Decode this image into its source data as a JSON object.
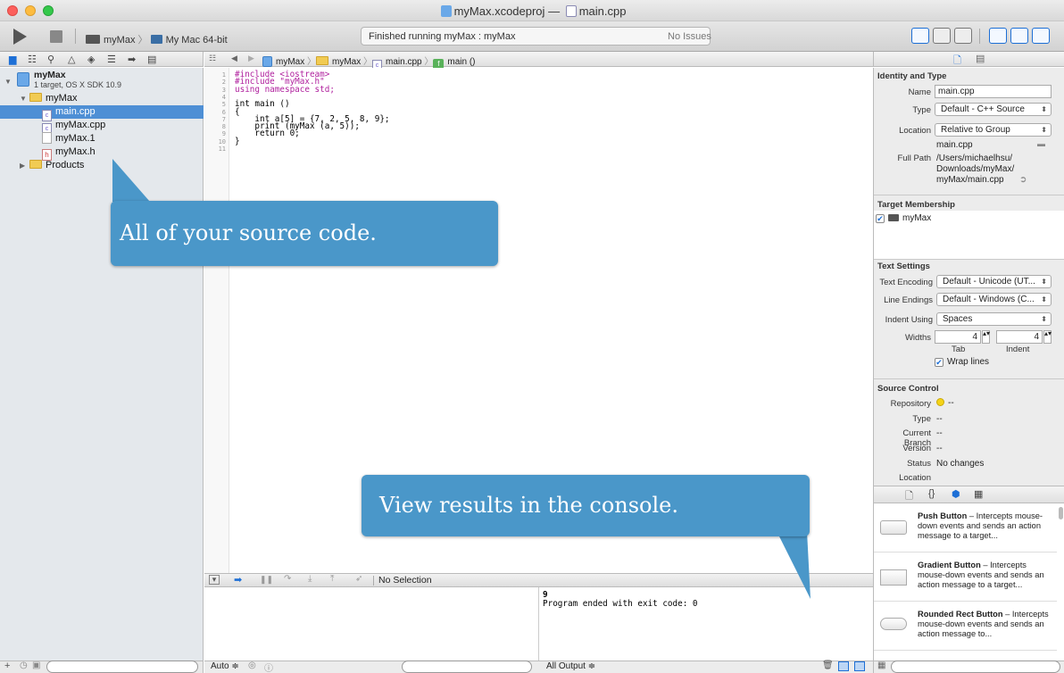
{
  "window": {
    "title_project": "myMax.xcodeproj",
    "title_sep": "—",
    "title_file": "main.cpp"
  },
  "toolbar": {
    "scheme": "myMax",
    "scheme_sep": "〉",
    "destination": "My Mac 64-bit",
    "activity": "Finished running myMax : myMax",
    "issues": "No Issues"
  },
  "navigator": {
    "project_name": "myMax",
    "project_sub": "1 target, OS X SDK 10.9",
    "items": [
      {
        "label": "myMax"
      },
      {
        "label": "main.cpp"
      },
      {
        "label": "myMax.cpp"
      },
      {
        "label": "myMax.1"
      },
      {
        "label": "myMax.h"
      },
      {
        "label": "Products"
      }
    ]
  },
  "jumpbar": {
    "crumb1": "myMax",
    "crumb2": "myMax",
    "crumb3": "main.cpp",
    "crumb4": "main ()"
  },
  "editor": {
    "line_numbers": [
      "1",
      "2",
      "3",
      "4",
      "5",
      "6",
      "7",
      "8",
      "9",
      "10",
      "11"
    ],
    "lines": [
      "#include <iostream>",
      "#include \"myMax.h\"",
      "using namespace std;",
      "",
      "int main ()",
      "{",
      "    int a[5] = {7, 2, 5, 8, 9};",
      "    print (myMax (a, 5));",
      "    return 0;",
      "}",
      ""
    ]
  },
  "debug": {
    "selection": "No Selection",
    "console_line1": "9",
    "console_line2": "Program ended with exit code: 0",
    "var_filter": "Auto ≑",
    "output_filter": "All Output ≑"
  },
  "inspector": {
    "identity_title": "Identity and Type",
    "name_label": "Name",
    "name_value": "main.cpp",
    "type_label": "Type",
    "type_value": "Default - C++ Source",
    "location_label": "Location",
    "location_value": "Relative to Group",
    "location_file": "main.cpp",
    "fullpath_label": "Full Path",
    "fullpath_value1": "/Users/michaelhsu/",
    "fullpath_value2": "Downloads/myMax/",
    "fullpath_value3": "myMax/main.cpp",
    "target_title": "Target Membership",
    "target_item": "myMax",
    "text_title": "Text Settings",
    "encoding_label": "Text Encoding",
    "encoding_value": "Default - Unicode (UT...",
    "endings_label": "Line Endings",
    "endings_value": "Default - Windows (C...",
    "indent_label": "Indent Using",
    "indent_value": "Spaces",
    "widths_label": "Widths",
    "tab_value": "4",
    "indent_width_value": "4",
    "tab_caption": "Tab",
    "indent_caption": "Indent",
    "wrap_label": "Wrap lines",
    "sc_title": "Source Control",
    "repo_label": "Repository",
    "repo_value": "--",
    "sc_type_label": "Type",
    "sc_type_value": "--",
    "branch_label": "Current Branch",
    "branch_value": "--",
    "version_label": "Version",
    "version_value": "--",
    "status_label": "Status",
    "status_value": "No changes",
    "loc_label": "Location"
  },
  "library": {
    "items": [
      {
        "title": "Push Button",
        "desc": " – Intercepts mouse-down events and sends an action message to a target..."
      },
      {
        "title": "Gradient Button",
        "desc": " – Intercepts mouse-down events and sends an action message to a target..."
      },
      {
        "title": "Rounded Rect Button",
        "desc": " – Intercepts mouse-down events and sends an action message to..."
      }
    ]
  },
  "callouts": {
    "source": "All of your source code.",
    "console": "View results in the console."
  },
  "colors": {
    "accent": "#4e8fd5",
    "callout": "#4a97c9"
  }
}
